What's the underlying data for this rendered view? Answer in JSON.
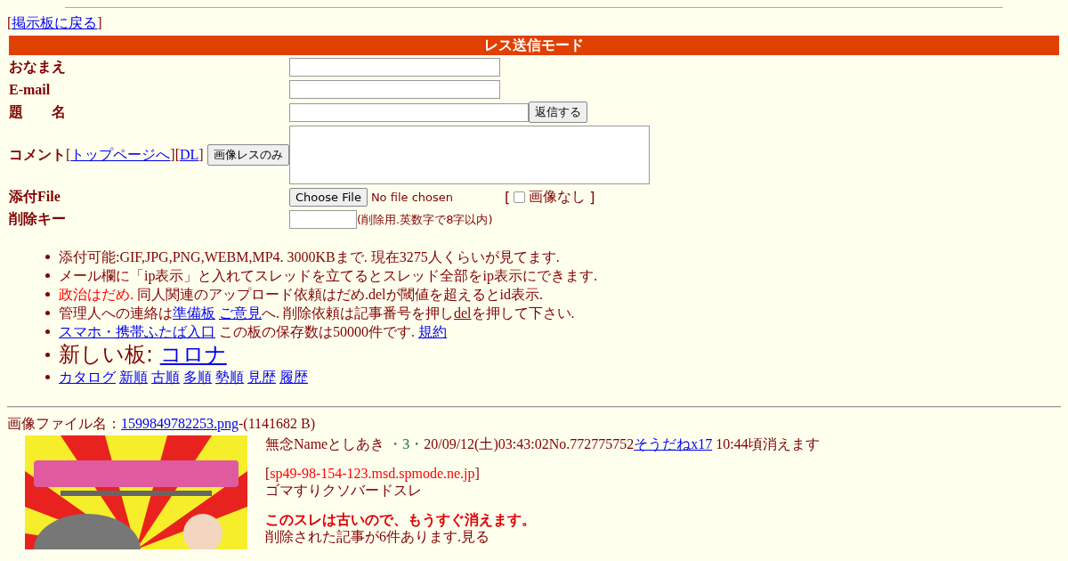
{
  "back_link": {
    "open": "[",
    "label": "掲示板に戻る",
    "close": "]"
  },
  "form": {
    "title": "レス送信モード",
    "rows": [
      {
        "kind": "text",
        "label": "おなまえ"
      },
      {
        "kind": "text",
        "label": "E-mail"
      },
      {
        "kind": "subject",
        "label": "題　　名",
        "button": "返信する"
      },
      {
        "kind": "comment",
        "label": "コメント",
        "links": [
          {
            "text": "[",
            "kind": "plain"
          },
          {
            "text": "トップページへ",
            "kind": "link"
          },
          {
            "text": "][",
            "kind": "plain"
          },
          {
            "text": "DL",
            "kind": "link"
          },
          {
            "text": "]",
            "kind": "plain"
          }
        ],
        "button": "画像レスのみ"
      },
      {
        "kind": "file",
        "label": "添付File",
        "button": "Choose File",
        "status": "No file chosen",
        "open": "[",
        "checkbox_label": "画像なし",
        "close": "]",
        "checked": false
      },
      {
        "kind": "key",
        "label": "削除キー",
        "note": "(削除用.英数字で8字以内)"
      }
    ]
  },
  "notices": [
    {
      "large": false,
      "segments": [
        {
          "text": "添付可能:GIF,JPG,PNG,WEBM,MP4. 3000KBまで. 現在3275人くらいが見てます.",
          "kind": "plain"
        }
      ]
    },
    {
      "large": false,
      "segments": [
        {
          "text": "メール欄に「ip表示」と入れてスレッドを立てるとスレッド全部をip表示にできます.",
          "kind": "plain"
        }
      ]
    },
    {
      "large": false,
      "segments": [
        {
          "text": "政治はだめ.",
          "kind": "red"
        },
        {
          "text": " 同人関連のアップロード依頼はだめ.delが閾値を超えるとid表示.",
          "kind": "plain"
        }
      ]
    },
    {
      "large": false,
      "segments": [
        {
          "text": "管理人への連絡は",
          "kind": "plain"
        },
        {
          "text": "準備板",
          "kind": "link"
        },
        {
          "text": "ご意見",
          "kind": "link"
        },
        {
          "text": "へ. 削除依頼は記事番号を押し",
          "kind": "plain"
        },
        {
          "text": "del",
          "kind": "darklink"
        },
        {
          "text": "を押して下さい.",
          "kind": "plain"
        }
      ]
    },
    {
      "large": false,
      "segments": [
        {
          "text": "スマホ・携帯ふたば入口",
          "kind": "link"
        },
        {
          "text": " この板の保存数は50000件です. ",
          "kind": "plain"
        },
        {
          "text": "規約",
          "kind": "link"
        }
      ]
    },
    {
      "large": true,
      "segments": [
        {
          "text": "新しい板: ",
          "kind": "plain"
        },
        {
          "text": "コロナ",
          "kind": "link"
        }
      ]
    },
    {
      "large": false,
      "segments": [
        {
          "text": "カタログ",
          "kind": "link"
        },
        {
          "text": "新順",
          "kind": "link"
        },
        {
          "text": "古順",
          "kind": "link"
        },
        {
          "text": "多順",
          "kind": "link"
        },
        {
          "text": "勢順",
          "kind": "link"
        },
        {
          "text": "見歴",
          "kind": "link"
        },
        {
          "text": "履歴",
          "kind": "link"
        }
      ]
    }
  ],
  "thread": {
    "file_line": [
      {
        "text": "画像ファイル名：",
        "kind": "plain"
      },
      {
        "text": "1599849782253.png",
        "kind": "link"
      },
      {
        "text": "-(1141682 B)",
        "kind": "plain"
      }
    ],
    "header": [
      {
        "text": "無念Nameとしあき ",
        "kind": "plain"
      },
      {
        "text": "・3・",
        "kind": "green"
      },
      {
        "text": "20/09/12(土)03:43:02No.772775752",
        "kind": "plain"
      },
      {
        "text": "そうだねx17",
        "kind": "link"
      },
      {
        "text": " 10:44頃消えます",
        "kind": "plain"
      }
    ],
    "ip": [
      {
        "text": "[",
        "kind": "plain"
      },
      {
        "text": "sp49-98-154-123.msd.spmode.ne.jp",
        "kind": "red"
      },
      {
        "text": "]",
        "kind": "plain"
      }
    ],
    "body": "ゴマすりクソバードスレ",
    "warning": "このスレは古いので、もうすぐ消えます。",
    "deleted_note": "削除された記事が6件あります.見る"
  }
}
